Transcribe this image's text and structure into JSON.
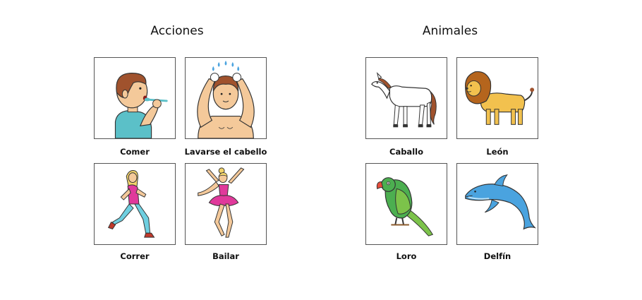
{
  "sections": [
    {
      "title": "Acciones",
      "cards": [
        {
          "label": "Comer",
          "icon": "person-eating-icon"
        },
        {
          "label": "Lavarse el cabello",
          "icon": "person-washing-hair-icon"
        },
        {
          "label": "Correr",
          "icon": "girl-running-icon"
        },
        {
          "label": "Bailar",
          "icon": "ballerina-dancing-icon"
        }
      ]
    },
    {
      "title": "Animales",
      "cards": [
        {
          "label": "Caballo",
          "icon": "horse-icon"
        },
        {
          "label": "León",
          "icon": "lion-icon"
        },
        {
          "label": "Loro",
          "icon": "parrot-icon"
        },
        {
          "label": "Delfín",
          "icon": "dolphin-icon"
        }
      ]
    }
  ],
  "colors": {
    "card_border": "#555555",
    "skin": "#f4c99a",
    "hair_brown": "#a0522d",
    "shirt_teal": "#5bc0c8",
    "water_drops": "#4aa3df",
    "tutu_pink": "#e0399b",
    "lion_yellow": "#f2c14e",
    "parrot_green": "#4caf50",
    "dolphin_blue": "#4aa3df"
  }
}
